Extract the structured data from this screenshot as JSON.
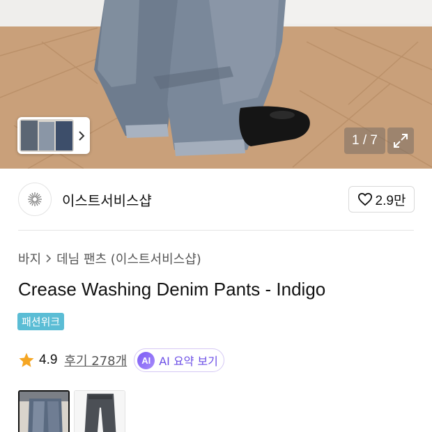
{
  "gallery": {
    "counter": "1 / 7",
    "thumbnail_strip_icon": "chevron-right-icon",
    "expand_icon": "expand-icon"
  },
  "shop": {
    "name": "이스트서비스샵",
    "logo_icon": "starburst-logo",
    "like_icon": "heart-icon",
    "like_count": "2.9만"
  },
  "breadcrumb": {
    "items": [
      "바지",
      "데님 팬츠 (이스트서비스샵)"
    ],
    "separator_icon": "chevron-right-icon"
  },
  "product": {
    "title": "Crease Washing Denim Pants - Indigo",
    "badge": "패션위크",
    "badge_color": "#5bbdd5"
  },
  "rating": {
    "star_icon": "star-icon",
    "star_color": "#f5a623",
    "value": "4.9",
    "reviews_label": "후기 278개"
  },
  "ai_summary": {
    "icon_text": "AI",
    "label": "AI 요약 보기",
    "accent": "#6b4ee6"
  },
  "thumbnails": [
    {
      "alt": "model-photo",
      "selected": true
    },
    {
      "alt": "product-flat-photo",
      "selected": false
    }
  ]
}
